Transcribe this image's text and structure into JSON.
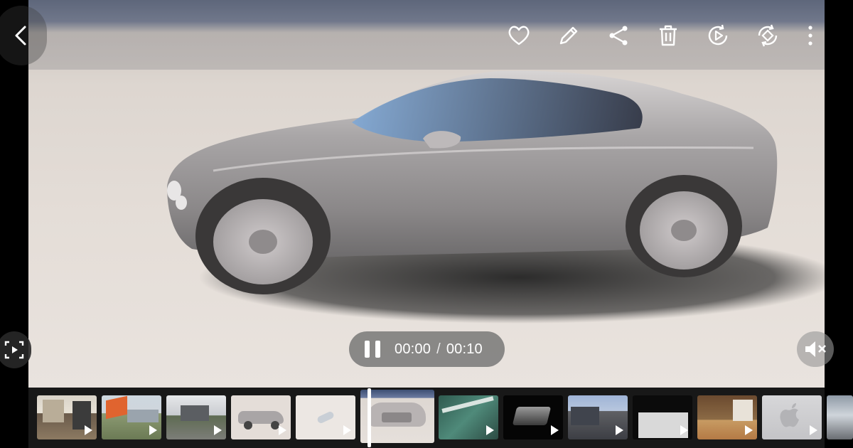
{
  "toolbar": {
    "back": "back-arrow-icon",
    "actions": [
      {
        "name": "favorite-button",
        "icon": "heart-icon"
      },
      {
        "name": "edit-button",
        "icon": "pencil-icon"
      },
      {
        "name": "share-button",
        "icon": "share-icon"
      },
      {
        "name": "delete-button",
        "icon": "trash-icon"
      },
      {
        "name": "play-clip-button",
        "icon": "play-rotate-icon"
      },
      {
        "name": "rotate-button",
        "icon": "rotate-icon"
      },
      {
        "name": "more-button",
        "icon": "more-vertical-icon"
      }
    ]
  },
  "player": {
    "current_time": "00:00",
    "separator": "/",
    "duration": "00:10",
    "state": "playing",
    "muted": true
  },
  "colors": {
    "icon": "#ffffff",
    "pill": "#6e6e6e",
    "car_body": "#9c9899"
  },
  "filmstrip": {
    "items": [
      {
        "theme": "interior-room",
        "active": false
      },
      {
        "theme": "building-exterior",
        "active": false
      },
      {
        "theme": "patio",
        "active": false
      },
      {
        "theme": "silver-car",
        "active": false
      },
      {
        "theme": "small-car-white",
        "active": false
      },
      {
        "theme": "car-front",
        "active": true
      },
      {
        "theme": "green-glass",
        "active": false
      },
      {
        "theme": "dark-device",
        "active": false
      },
      {
        "theme": "street-houses",
        "active": false
      },
      {
        "theme": "ryzen-threadripper",
        "active": false
      },
      {
        "theme": "kitchen",
        "active": false
      },
      {
        "theme": "apple-logo",
        "active": false
      },
      {
        "theme": "partial-building",
        "active": false
      }
    ]
  }
}
